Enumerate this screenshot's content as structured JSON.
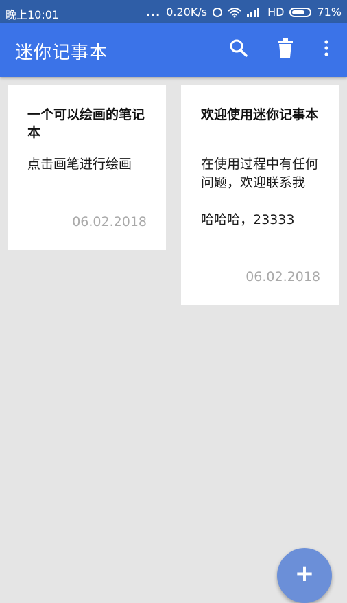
{
  "status_bar": {
    "time": "晚上10:01",
    "dots": "...",
    "speed": "0.20K/s",
    "network": "HD",
    "battery": "71%",
    "icons": [
      "alarm-icon",
      "wifi-icon",
      "signal-icon",
      "battery-icon"
    ]
  },
  "app_bar": {
    "title": "迷你记事本",
    "actions": [
      "search-icon",
      "delete-icon",
      "more-vert-icon"
    ]
  },
  "notes": [
    {
      "title": "一个可以绘画的笔记本",
      "body": "点击画笔进行绘画",
      "date": "06.02.2018"
    },
    {
      "title": "欢迎使用迷你记事本",
      "body": "在使用过程中有任何问题，欢迎联系我\n\n哈哈哈，23333",
      "date": "06.02.2018"
    }
  ],
  "fab": {
    "label": "+",
    "icon": "add-icon"
  },
  "colors": {
    "status_bar": "#2f5ea7",
    "app_bar": "#3b73e8",
    "background": "#e5e5e5",
    "card": "#ffffff",
    "date_text": "#a9a9a9",
    "fab": "#6b8fd8"
  }
}
